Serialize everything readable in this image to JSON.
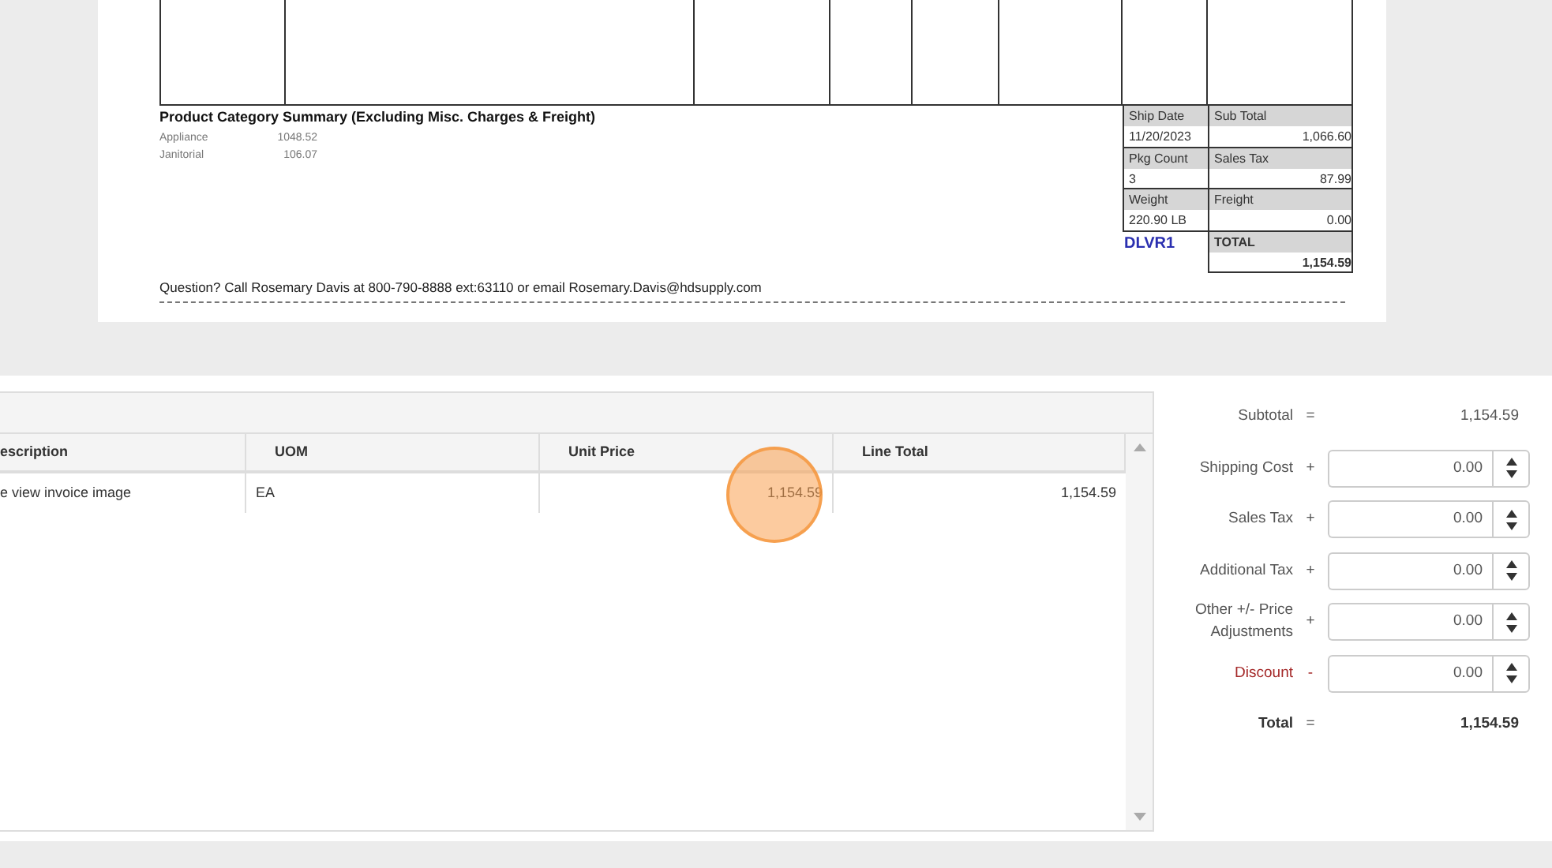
{
  "invoice": {
    "category_summary": {
      "title": "Product Category Summary (Excluding Misc. Charges & Freight)",
      "rows": [
        {
          "category": "Appliance",
          "amount": "1048.52"
        },
        {
          "category": "Janitorial",
          "amount": "106.07"
        }
      ]
    },
    "ship_info": [
      {
        "label": "Ship Date",
        "value": "11/20/2023"
      },
      {
        "label": "Pkg Count",
        "value": "3"
      },
      {
        "label": "Weight",
        "value": "220.90 LB"
      }
    ],
    "route_code": "DLVR1",
    "totals": [
      {
        "label": "Sub Total",
        "value": "1,066.60",
        "kind": "plain"
      },
      {
        "label": "Sales Tax",
        "value": "87.99",
        "kind": "plain"
      },
      {
        "label": "Freight",
        "value": "0.00",
        "kind": "plain"
      },
      {
        "label": "TOTAL",
        "value": "1,154.59",
        "kind": "grand"
      }
    ],
    "contact_note": "Question? Call Rosemary Davis at 800-790-8888 ext:63110 or email Rosemary.Davis@hdsupply.com"
  },
  "lines_grid": {
    "columns": [
      "escription",
      "UOM",
      "Unit Price",
      "Line Total"
    ],
    "rows": [
      [
        "e view invoice image",
        "EA",
        "1,154.59",
        "1,154.59"
      ]
    ]
  },
  "summary": {
    "rows": [
      {
        "kind": "text",
        "label": "Subtotal",
        "operator": "=",
        "value": "1,154.59"
      },
      {
        "kind": "input",
        "label": "Shipping Cost",
        "operator": "+",
        "value": "0.00"
      },
      {
        "kind": "input",
        "label": "Sales Tax",
        "operator": "+",
        "value": "0.00"
      },
      {
        "kind": "input",
        "label": "Additional Tax",
        "operator": "+",
        "value": "0.00"
      },
      {
        "kind": "input",
        "label": "Other +/- Price Adjustments",
        "operator": "+",
        "value": "0.00"
      },
      {
        "kind": "input",
        "label": "Discount",
        "operator": "-",
        "value": "0.00",
        "color": "#a52a2a"
      },
      {
        "kind": "total",
        "label": "Total",
        "operator": "=",
        "value": "1,154.59"
      }
    ]
  }
}
